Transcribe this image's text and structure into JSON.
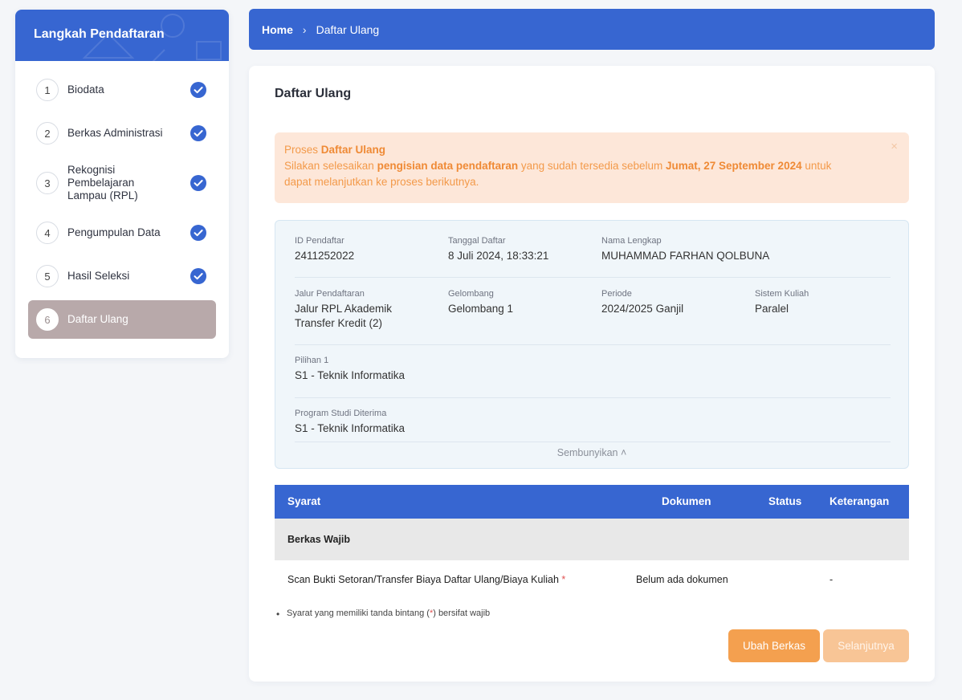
{
  "sidebar": {
    "title": "Langkah Pendaftaran",
    "steps": [
      {
        "num": "1",
        "label": "Biodata",
        "done": true
      },
      {
        "num": "2",
        "label": "Berkas Administrasi",
        "done": true
      },
      {
        "num": "3",
        "label": "Rekognisi Pembelajaran Lampau (RPL)",
        "done": true
      },
      {
        "num": "4",
        "label": "Pengumpulan Data",
        "done": true
      },
      {
        "num": "5",
        "label": "Hasil Seleksi",
        "done": true
      },
      {
        "num": "6",
        "label": "Daftar Ulang",
        "done": false,
        "active": true
      }
    ]
  },
  "breadcrumb": {
    "home": "Home",
    "separator": "›",
    "current": "Daftar Ulang"
  },
  "page": {
    "title": "Daftar Ulang"
  },
  "alert": {
    "prefix": "Proses ",
    "title": "Daftar Ulang",
    "line1_a": "Silakan selesaikan ",
    "line1_b": "pengisian data pendaftaran",
    "line1_c": " yang sudah tersedia sebelum ",
    "line1_d": "Jumat, 27 September 2024",
    "line1_e": " untuk",
    "line2": "dapat melanjutkan ke proses berikutnya.",
    "close": "×"
  },
  "info": {
    "id_label": "ID Pendaftar",
    "id_value": "2411252022",
    "date_label": "Tanggal Daftar",
    "date_value": "8 Juli 2024, 18:33:21",
    "name_label": "Nama Lengkap",
    "name_value": "MUHAMMAD FARHAN QOLBUNA",
    "jalur_label": "Jalur Pendaftaran",
    "jalur_value_1": "Jalur RPL Akademik",
    "jalur_value_2": "Transfer Kredit (2)",
    "gelombang_label": "Gelombang",
    "gelombang_value": "Gelombang 1",
    "periode_label": "Periode",
    "periode_value": "2024/2025 Ganjil",
    "sistem_label": "Sistem Kuliah",
    "sistem_value": "Paralel",
    "pilihan_label": "Pilihan 1",
    "pilihan_value": "S1 - Teknik Informatika",
    "prodi_label": "Program Studi Diterima",
    "prodi_value": "S1 - Teknik Informatika",
    "toggle": "Sembunyikan ˄"
  },
  "table": {
    "headers": {
      "syarat": "Syarat",
      "dokumen": "Dokumen",
      "status": "Status",
      "keterangan": "Keterangan"
    },
    "group": "Berkas Wajib",
    "rows": [
      {
        "syarat": "Scan Bukti Setoran/Transfer Biaya Daftar Ulang/Biaya Kuliah",
        "required": "*",
        "dokumen": "Belum ada dokumen",
        "status": "",
        "keterangan": "-"
      }
    ]
  },
  "note": {
    "a": "Syarat yang memiliki tanda bintang (",
    "star": "*",
    "b": ") bersifat wajib"
  },
  "buttons": {
    "ubah": "Ubah Berkas",
    "next": "Selanjutnya"
  },
  "colors": {
    "primary": "#3766d1",
    "accent": "#f4a04f",
    "active_step": "#b8a9aa"
  }
}
